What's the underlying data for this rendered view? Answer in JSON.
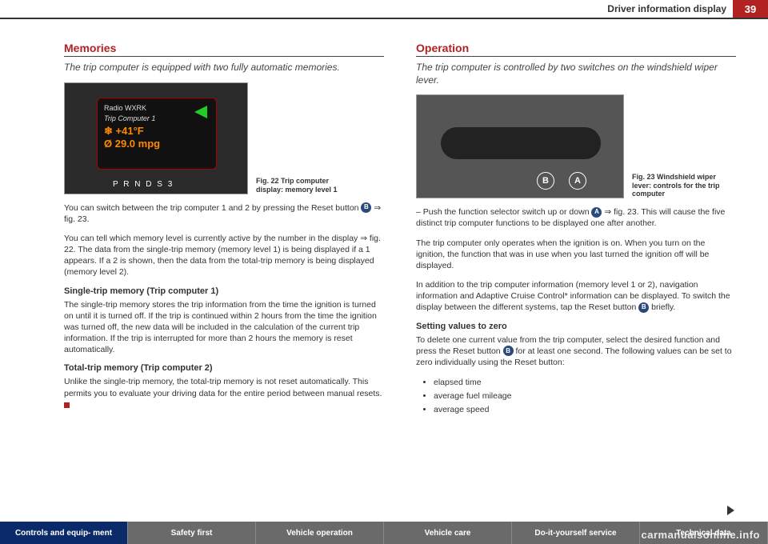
{
  "header": {
    "section": "Driver information display",
    "page": "39"
  },
  "left": {
    "title": "Memories",
    "subtitle": "The trip computer is equipped with two fully automatic memories.",
    "fig": {
      "radio": "Radio WXRK",
      "tc": "Trip Computer 1",
      "temp": "+41°F",
      "mpg": "29.0 mpg",
      "gear": "P R N D S  3",
      "caption": "Fig. 22  Trip computer display: memory level 1"
    },
    "p1a": "You can switch between the trip computer 1 and 2 by pressing the Reset button ",
    "p1b": " ⇒ fig. 23.",
    "p2": "You can tell which memory level is currently active by the number in the display ⇒ fig. 22. The data from the single-trip memory (memory level 1) is being displayed if a 1 appears. If a 2 is shown, then the data from the total-trip memory is being displayed (memory level 2).",
    "h1": "Single-trip memory (Trip computer 1)",
    "p3": "The single-trip memory stores the trip information from the time the ignition is turned on until it is turned off. If the trip is continued within 2 hours from the time the ignition was turned off, the new data will be included in the calculation of the current trip information. If the trip is interrupted for more than 2 hours the memory is reset automatically.",
    "h2": "Total-trip memory (Trip computer 2)",
    "p4": "Unlike the single-trip memory, the total-trip memory is not reset automatically. This permits you to evaluate your driving data for the entire period between manual resets."
  },
  "right": {
    "title": "Operation",
    "subtitle": "The trip computer is controlled by two switches on the windshield wiper lever.",
    "fig": {
      "caption": "Fig. 23  Windshield wiper lever: controls for the trip computer",
      "a": "A",
      "b": "B"
    },
    "step1a": "– Push the function selector switch up or down ",
    "step1b": " ⇒ fig. 23. This will cause the five distinct trip computer functions to be displayed one after another.",
    "p1": "The trip computer only operates when the ignition is on. When you turn on the ignition, the function that was in use when you last turned the ignition off will be displayed.",
    "p2a": "In addition to the trip computer information (memory level 1 or 2), navigation information and Adaptive Cruise Control* information can be displayed. To switch the display between the different systems, tap the Reset button ",
    "p2b": " briefly.",
    "h1": "Setting values to zero",
    "p3a": "To delete one current value from the trip computer, select the desired function and press the Reset button ",
    "p3b": " for at least one second. The following values can be set to zero individually using the Reset button:",
    "bullets": [
      "elapsed time",
      "average fuel mileage",
      "average speed"
    ]
  },
  "circles": {
    "A": "A",
    "B": "B"
  },
  "tabs": [
    "Controls and equip-\nment",
    "Safety first",
    "Vehicle operation",
    "Vehicle care",
    "Do-it-yourself service",
    "Technical data"
  ],
  "watermark": "carmanualsonline.info"
}
